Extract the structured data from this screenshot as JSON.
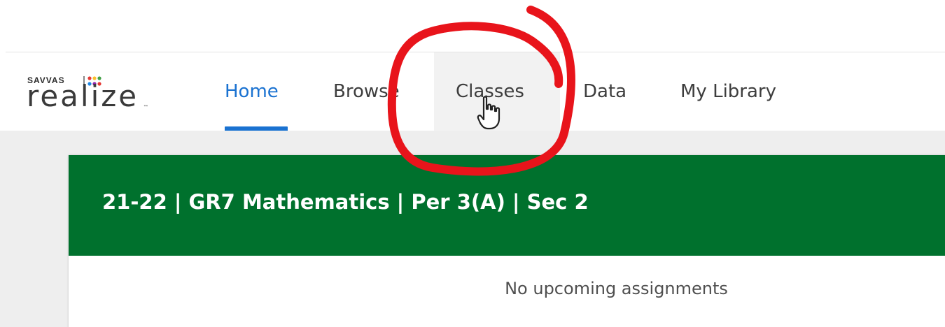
{
  "logo": {
    "brand_small": "SAVVAS",
    "brand_big": "realize",
    "trademark": "™",
    "dot_colors": [
      "#e53935",
      "#fbc02d",
      "#43a047",
      "#1e88e5",
      "#8e24aa",
      "#e53935"
    ]
  },
  "nav": {
    "items": [
      {
        "label": "Home",
        "active": true
      },
      {
        "label": "Browse",
        "active": false
      },
      {
        "label": "Classes",
        "active": false,
        "hovered": true
      },
      {
        "label": "Data",
        "active": false
      },
      {
        "label": "My Library",
        "active": false
      }
    ]
  },
  "class_card": {
    "title": "21-22 | GR7 Mathematics | Per 3(A) | Sec 2",
    "empty_message": "No upcoming assignments"
  },
  "annotation": {
    "shape": "circle",
    "color": "#e8141b",
    "target": "Classes"
  },
  "cursor": {
    "icon": "hand-pointer-icon"
  },
  "colors": {
    "accent": "#1a72d1",
    "header_green": "#00712d",
    "content_bg": "#eeeeee"
  }
}
